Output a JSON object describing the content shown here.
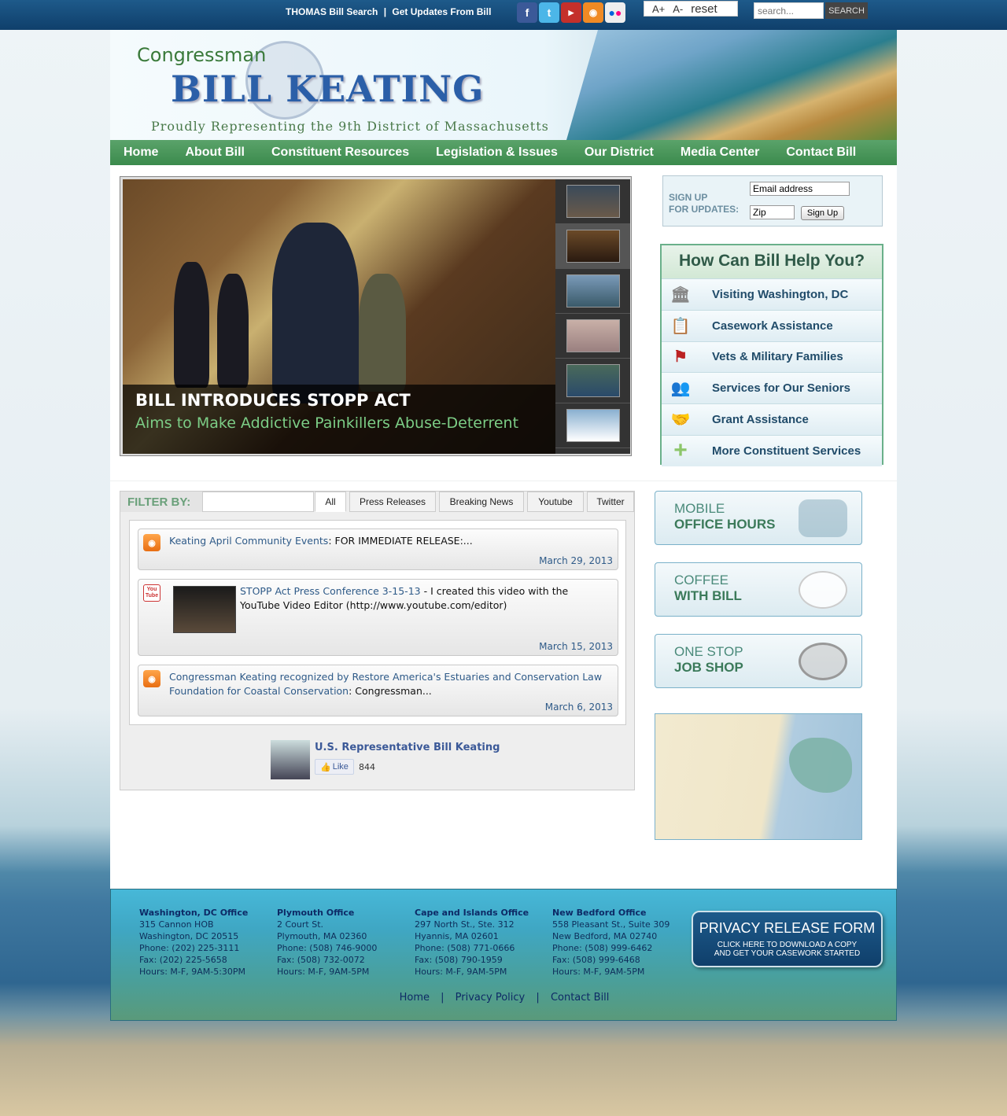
{
  "topbar": {
    "link_thomas": "THOMAS Bill Search",
    "separator": "|",
    "link_updates": "Get Updates From Bill",
    "font_increase": "A+",
    "font_decrease": "A-",
    "font_reset": "reset",
    "search_placeholder": "search...",
    "search_button": "SEARCH"
  },
  "header": {
    "title_small": "Congressman",
    "title_name": "BILL KEATING",
    "subtitle": "Proudly Representing the 9th District of Massachusetts"
  },
  "nav": [
    "Home",
    "About Bill",
    "Constituent Resources",
    "Legislation & Issues",
    "Our District",
    "Media Center",
    "Contact Bill"
  ],
  "slideshow": {
    "caption_title": "BILL INTRODUCES STOPP ACT",
    "caption_sub": "Aims to Make Addictive Painkillers Abuse-Deterrent"
  },
  "signup": {
    "label_line1": "SIGN UP",
    "label_line2": "FOR UPDATES:",
    "email_value": "Email address",
    "zip_value": "Zip",
    "button": "Sign Up"
  },
  "help": {
    "title": "How Can Bill Help You?",
    "items": [
      "Visiting Washington, DC",
      "Casework Assistance",
      "Vets & Military Families",
      "Services for Our Seniors",
      "Grant Assistance",
      "More Constituent Services"
    ]
  },
  "filter": {
    "label": "FILTER BY:",
    "tabs": [
      "All",
      "Press Releases",
      "Breaking News",
      "Youtube",
      "Twitter"
    ]
  },
  "feed": [
    {
      "link": "Keating April Community Events",
      "rest": ": FOR IMMEDIATE RELEASE:...",
      "date": "March 29, 2013"
    },
    {
      "link": "STOPP Act Press Conference 3-15-13",
      "rest": " - I created this video with the YouTube Video Editor (http://www.youtube.com/editor)",
      "date": "March 15, 2013"
    },
    {
      "link": "Congressman Keating recognized by Restore America's Estuaries and Conservation Law Foundation for Coastal Conservation",
      "rest": ": Congressman...",
      "date": "March 6, 2013"
    }
  ],
  "facebook": {
    "name": "U.S. Representative Bill Keating",
    "like": "Like",
    "count": "844"
  },
  "promos": [
    {
      "l1": "MOBILE",
      "l2": "OFFICE HOURS"
    },
    {
      "l1": "COFFEE",
      "l2": "WITH BILL"
    },
    {
      "l1": "ONE STOP",
      "l2": "JOB SHOP"
    }
  ],
  "footer": {
    "offices": [
      {
        "title": "Washington, DC Office",
        "l1": "315 Cannon HOB",
        "l2": "Washington, DC 20515",
        "l3": "Phone: (202) 225-3111",
        "l4": "Fax: (202) 225-5658",
        "l5": "Hours: M-F, 9AM-5:30PM"
      },
      {
        "title": "Plymouth Office",
        "l1": "2 Court St.",
        "l2": "Plymouth, MA 02360",
        "l3": "Phone: (508) 746-9000",
        "l4": "Fax: (508) 732-0072",
        "l5": "Hours: M-F, 9AM-5PM"
      },
      {
        "title": "Cape and Islands Office",
        "l1": "297 North St., Ste. 312",
        "l2": "Hyannis, MA 02601",
        "l3": "Phone: (508) 771-0666",
        "l4": "Fax: (508) 790-1959",
        "l5": "Hours: M-F, 9AM-5PM"
      },
      {
        "title": "New Bedford Office",
        "l1": "558 Pleasant St., Suite 309",
        "l2": "New Bedford, MA  02740",
        "l3": "Phone:  (508) 999-6462",
        "l4": "Fax:  (508) 999-6468",
        "l5": "Hours: M-F, 9AM-5PM"
      }
    ],
    "privacy_title": "PRIVACY RELEASE FORM",
    "privacy_line1": "CLICK HERE TO DOWNLOAD A COPY",
    "privacy_line2": "AND GET YOUR CASEWORK STARTED",
    "links": [
      "Home",
      "Privacy Policy",
      "Contact Bill"
    ],
    "link_sep": "|"
  }
}
